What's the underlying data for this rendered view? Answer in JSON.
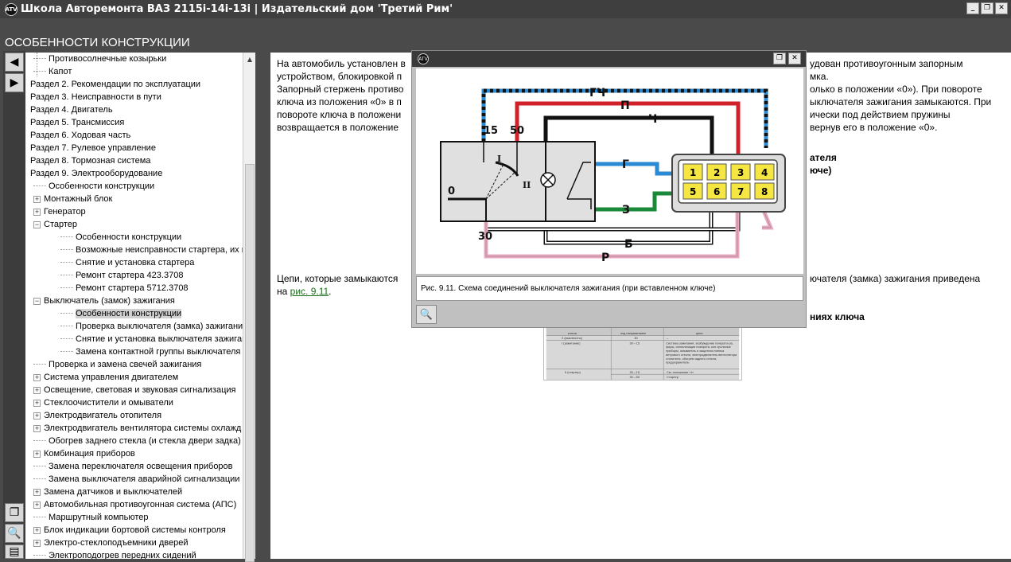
{
  "window": {
    "title": "Школа Авторемонта ВАЗ 2115i-14i-13i | Издательский дом 'Третий Рим'"
  },
  "page": {
    "title": "ОСОБЕННОСТИ КОНСТРУКЦИИ"
  },
  "tree": [
    {
      "label": "Противосолнечные козырьки",
      "indent": 1,
      "pm": ""
    },
    {
      "label": "Капот",
      "indent": 1,
      "pm": ""
    },
    {
      "label": "Раздел 2. Рекомендации по эксплуатации",
      "indent": 0,
      "pm": ""
    },
    {
      "label": "Раздел 3. Неисправности в пути",
      "indent": 0,
      "pm": ""
    },
    {
      "label": "Раздел 4. Двигатель",
      "indent": 0,
      "pm": ""
    },
    {
      "label": "Раздел 5. Трансмиссия",
      "indent": 0,
      "pm": ""
    },
    {
      "label": "Раздел 6. Ходовая часть",
      "indent": 0,
      "pm": ""
    },
    {
      "label": "Раздел 7. Рулевое управление",
      "indent": 0,
      "pm": ""
    },
    {
      "label": "Раздел 8. Тормозная система",
      "indent": 0,
      "pm": ""
    },
    {
      "label": "Раздел 9. Электрооборудование",
      "indent": 0,
      "pm": ""
    },
    {
      "label": "Особенности конструкции",
      "indent": 1,
      "pm": ""
    },
    {
      "label": "Монтажный блок",
      "indent": 1,
      "pm": "+"
    },
    {
      "label": "Генератор",
      "indent": 1,
      "pm": "+"
    },
    {
      "label": "Стартер",
      "indent": 1,
      "pm": "-"
    },
    {
      "label": "Особенности конструкции",
      "indent": 2,
      "pm": ""
    },
    {
      "label": "Возможные неисправности стартера, их при",
      "indent": 2,
      "pm": ""
    },
    {
      "label": "Снятие и установка стартера",
      "indent": 2,
      "pm": ""
    },
    {
      "label": "Ремонт стартера 423.3708",
      "indent": 2,
      "pm": ""
    },
    {
      "label": "Ремонт стартера 5712.3708",
      "indent": 2,
      "pm": ""
    },
    {
      "label": "Выключатель (замок) зажигания",
      "indent": 1,
      "pm": "-"
    },
    {
      "label": "Особенности конструкции",
      "indent": 2,
      "pm": "",
      "selected": true
    },
    {
      "label": "Проверка выключателя (замка) зажигания",
      "indent": 2,
      "pm": ""
    },
    {
      "label": "Снятие и установка выключателя зажигания",
      "indent": 2,
      "pm": ""
    },
    {
      "label": "Замена контактной группы выключателя заж",
      "indent": 2,
      "pm": ""
    },
    {
      "label": "Проверка и замена свечей зажигания",
      "indent": 1,
      "pm": ""
    },
    {
      "label": "Система управления двигателем",
      "indent": 1,
      "pm": "+"
    },
    {
      "label": "Освещение, световая и звуковая сигнализация",
      "indent": 1,
      "pm": "+"
    },
    {
      "label": "Стеклоочистители и омыватели",
      "indent": 1,
      "pm": "+"
    },
    {
      "label": "Электродвигатель отопителя",
      "indent": 1,
      "pm": "+"
    },
    {
      "label": "Электродвигатель вентилятора системы охлажд",
      "indent": 1,
      "pm": "+"
    },
    {
      "label": "Обогрев заднего стекла (и стекла двери задка)",
      "indent": 1,
      "pm": ""
    },
    {
      "label": "Комбинация приборов",
      "indent": 1,
      "pm": "+"
    },
    {
      "label": "Замена переключателя освещения приборов",
      "indent": 1,
      "pm": ""
    },
    {
      "label": "Замена выключателя аварийной сигнализации",
      "indent": 1,
      "pm": ""
    },
    {
      "label": "Замена датчиков и выключателей",
      "indent": 1,
      "pm": "+"
    },
    {
      "label": "Автомобильная противоугонная система (АПС)",
      "indent": 1,
      "pm": "+"
    },
    {
      "label": "Маршрутный компьютер",
      "indent": 1,
      "pm": ""
    },
    {
      "label": "Блок индикации бортовой системы контроля",
      "indent": 1,
      "pm": "+"
    },
    {
      "label": "Электро-стеклоподъемники дверей",
      "indent": 1,
      "pm": "+"
    },
    {
      "label": "Электроподогрев передних сидений",
      "indent": 1,
      "pm": ""
    }
  ],
  "content": {
    "p1a": "На автомобиль установлен в",
    "p1b": "удован противоугонным запорным",
    "p2a": "устройством, блокировкой п",
    "p2b": "мка.",
    "p3a": "Запорный стержень противо",
    "p3b": "олько в положении «0»). При повороте",
    "p4a": "ключа из положения «0» в п",
    "p4b": "ыключателя зажигания замыкаются. При",
    "p5a": "повороте ключа в положени",
    "p5b": "ически под действием пружины",
    "p6a": "возвращается в положение",
    "p6b": "вернув его в положение «0».",
    "h1b": "ателя",
    "h2b": "юче)",
    "p7a": "Цепи, которые замыкаются",
    "p7b": "ючателя (замка) зажигания приведена",
    "p8a": "на",
    "p8link": "рис. 9.11",
    "p8c": ".",
    "h3b": "ниях ключа"
  },
  "popup": {
    "caption": "Рис. 9.11. Схема соединений выключателя зажигания (при вставленном ключе)",
    "labels": {
      "gch": "ГЧ",
      "p": "П",
      "ch": "Ч",
      "g": "Г",
      "z": "З",
      "b": "Б",
      "r": "Р",
      "n15": "15",
      "n50": "50",
      "n30": "30",
      "n0": "0",
      "rI": "I",
      "rII": "II",
      "pins": [
        "1",
        "2",
        "3",
        "4",
        "5",
        "6",
        "7",
        "8"
      ]
    },
    "colors": {
      "blue": "#2a8ad4",
      "red": "#d0202a",
      "black": "#111111",
      "green": "#1a8a3a",
      "pink": "#e8a8c0"
    }
  },
  "table_img": {
    "headers": [
      "ключа",
      "под напряжением",
      "цепи"
    ],
    "rows": [
      [
        "0 (выключено)",
        "30",
        "–"
      ],
      [
        "I (зажигание)",
        "30→15",
        "Система зажигания, возбуждение генерато-ра, фары, сигнализация поворота, кон-трольные приборы, омыватель и защитная пленка ветрового стекла, электродвигатель вентилятора отопителя, обогрев заднего стекла, предохранитель"
      ],
      [
        "II (стартер)",
        "30→15",
        "См. положение «I»"
      ],
      [
        "",
        "30→50",
        "Стартер"
      ]
    ]
  }
}
